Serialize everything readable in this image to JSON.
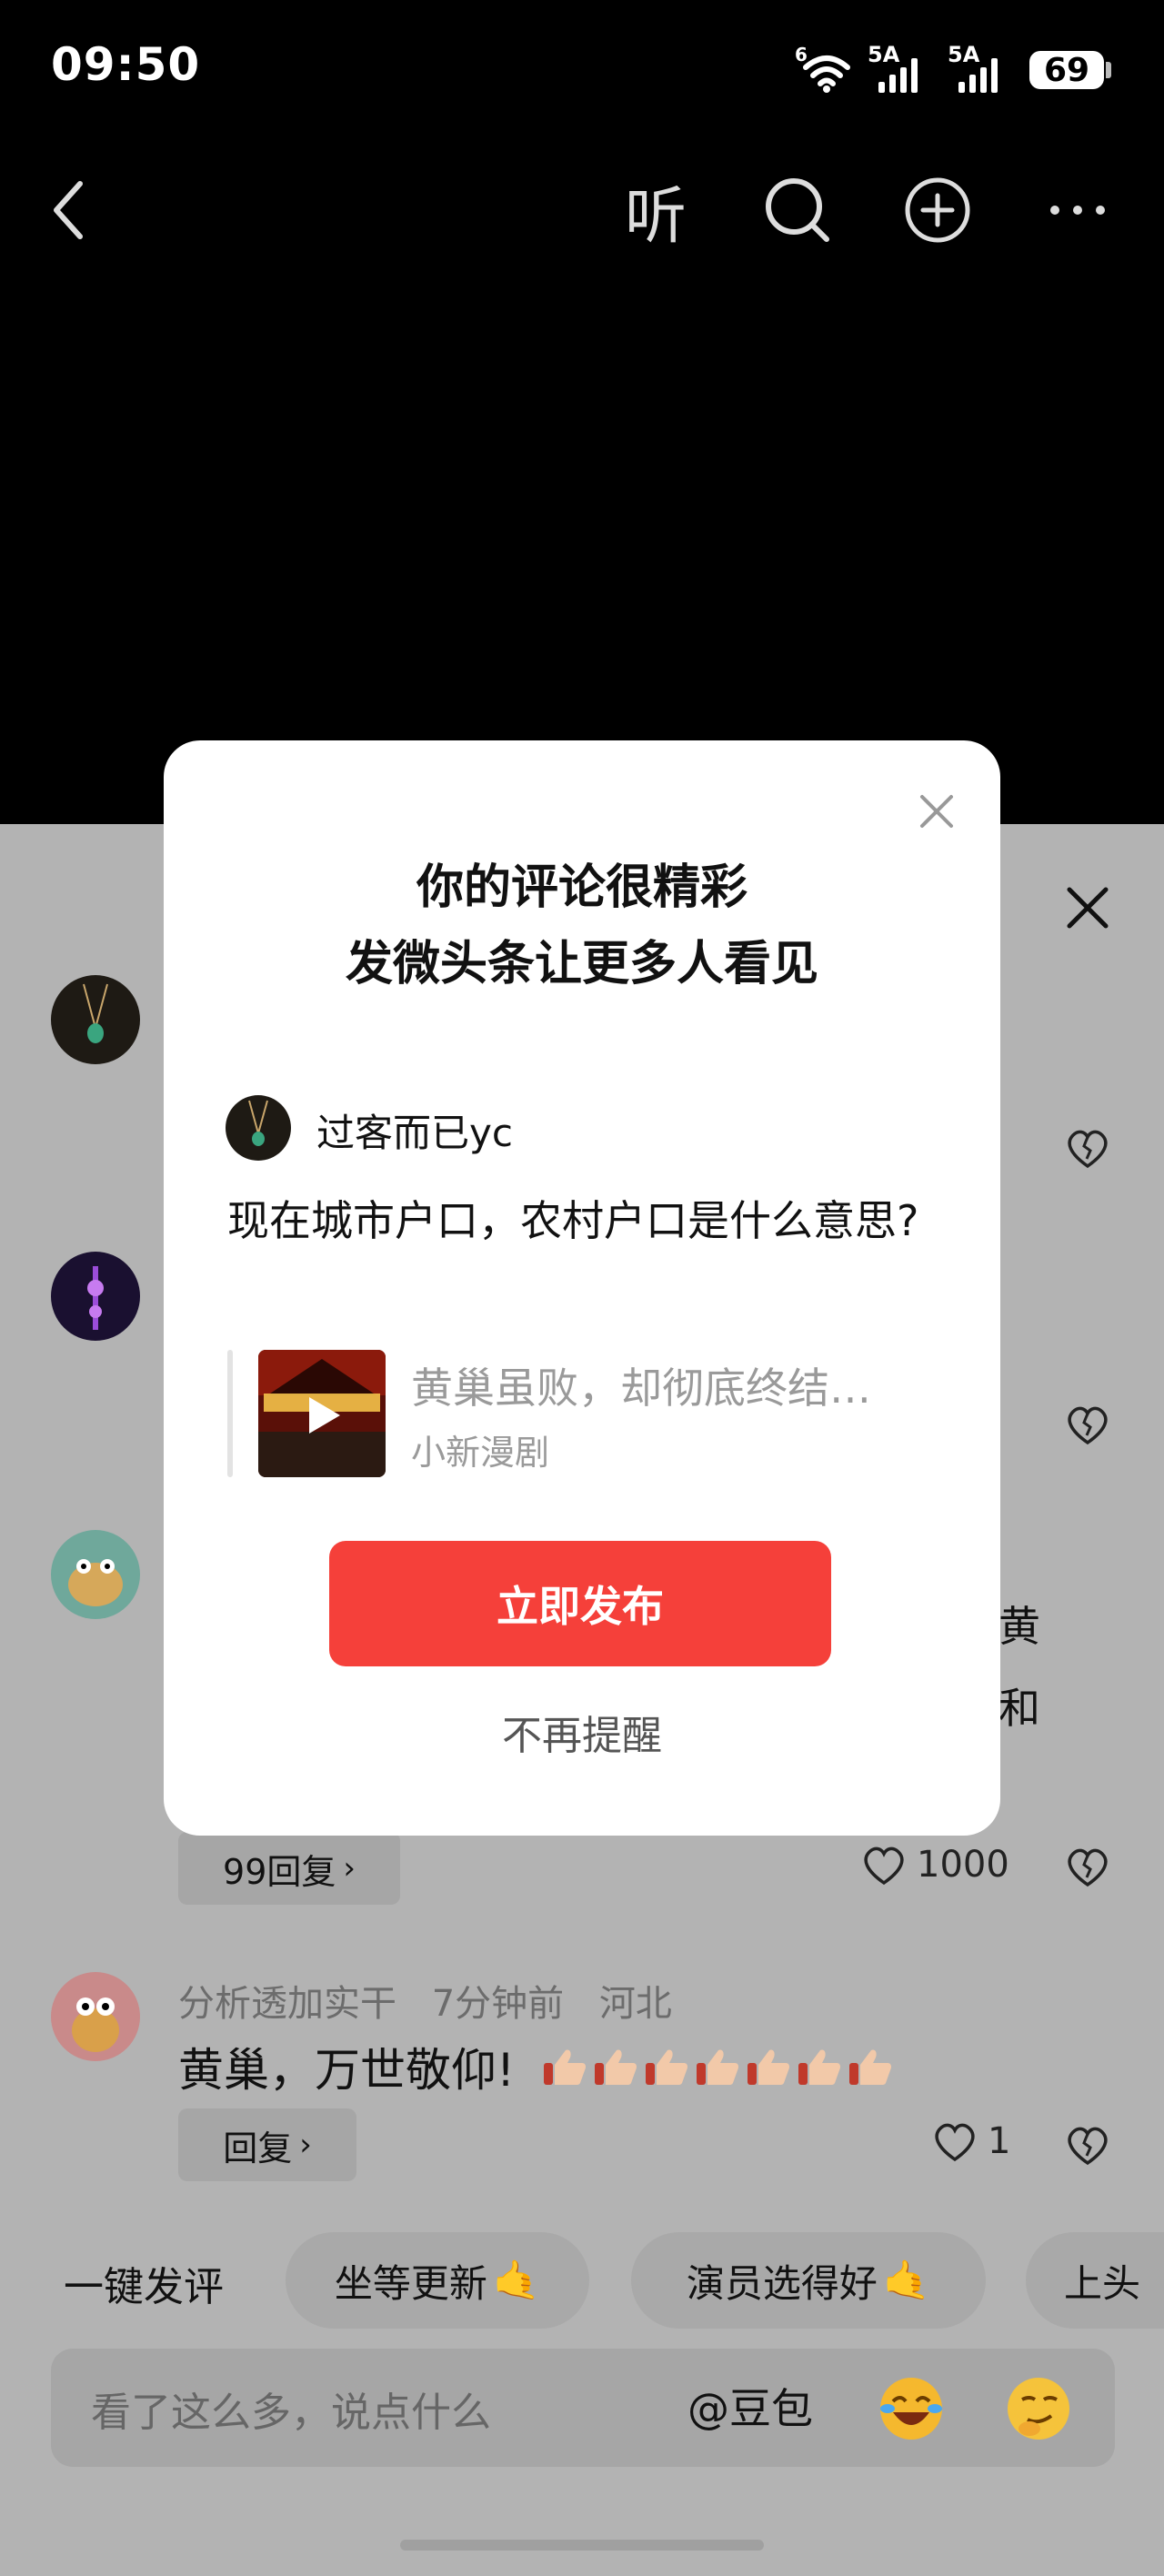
{
  "status_bar": {
    "time": "09:50",
    "wifi_badge": "6",
    "signal_1": "5A",
    "signal_2": "5A",
    "battery": "69"
  },
  "top_nav": {
    "listen_label": "听",
    "icons": [
      "back-icon",
      "search-icon",
      "add-icon",
      "more-icon"
    ]
  },
  "modal": {
    "title_line1": "你的评论很精彩",
    "title_line2": "发微头条让更多人看见",
    "username": "过客而已yc",
    "post_text": "现在城市户口，农村户口是什么意思?",
    "quote_title": "黄巢虽败，却彻底终结…",
    "quote_source": "小新漫剧",
    "publish_label": "立即发布",
    "dismiss_label": "不再提醒"
  },
  "comments": {
    "c3": {
      "right_fragment_1": "黄",
      "right_fragment_2": "和",
      "reply_label": "99回复",
      "likes": "1000"
    },
    "c4": {
      "username": "分析透加实干",
      "time": "7分钟前",
      "location": "河北",
      "text": "黄巢，万世敬仰!",
      "reply_label": "回复",
      "likes": "1"
    }
  },
  "quick_comments": {
    "label": "一键发评",
    "chips": [
      "坐等更新",
      "演员选得好",
      "上头"
    ]
  },
  "input": {
    "placeholder": "看了这么多，说点什么",
    "at_label": "@豆包"
  },
  "colors": {
    "accent": "#f5403a",
    "sheet_dim": "#b3b3b3",
    "background": "#000000"
  }
}
